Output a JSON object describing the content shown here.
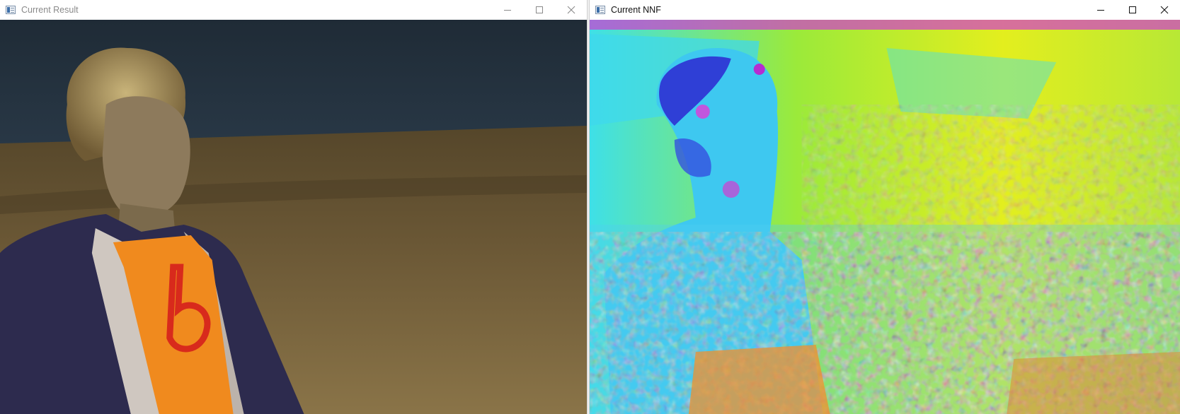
{
  "windows": [
    {
      "title": "Current Result",
      "active": false,
      "content": "photo of a blond man in an orange t-shirt and dark hoodie standing in a grass field under a dark sky"
    },
    {
      "title": "Current NNF",
      "active": true,
      "content": "colorful nearest-neighbor-field visualization of the same scene"
    }
  ],
  "icons": {
    "app": "app-window-icon",
    "minimize": "minimize-icon",
    "maximize": "maximize-icon",
    "close": "close-icon"
  },
  "colors": {
    "titlebar_bg": "#ffffff",
    "inactive_text": "#8a8a8a",
    "active_text": "#111111",
    "sky": "#1f2e3b",
    "field": "#6d5b38",
    "shirt": "#f08a1e",
    "hoodie": "#2d2b4e",
    "nnf_cyan": "#34d6f0",
    "nnf_yellow": "#e5f21a",
    "nnf_blue": "#2b3fe0",
    "nnf_magenta": "#e23ad8"
  }
}
